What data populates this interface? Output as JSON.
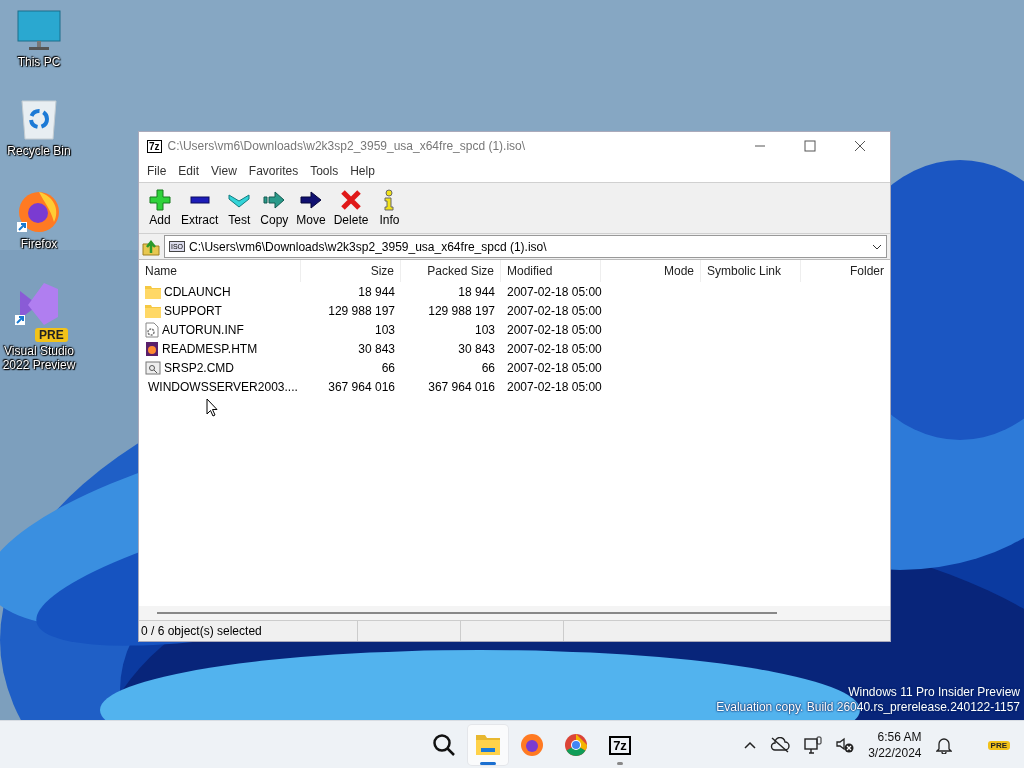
{
  "desktop_icons": [
    {
      "kind": "pc",
      "label": "This PC"
    },
    {
      "kind": "bin",
      "label": "Recycle Bin"
    },
    {
      "kind": "firefox",
      "label": "Firefox"
    },
    {
      "kind": "vs",
      "label": "Visual Studio 2022 Preview",
      "badge": "PRE"
    }
  ],
  "window": {
    "title": "C:\\Users\\vm6\\Downloads\\w2k3sp2_3959_usa_x64fre_spcd (1).iso\\",
    "app_icon": "7z"
  },
  "menu": [
    "File",
    "Edit",
    "View",
    "Favorites",
    "Tools",
    "Help"
  ],
  "toolbar": [
    {
      "kind": "add",
      "label": "Add"
    },
    {
      "kind": "extract",
      "label": "Extract"
    },
    {
      "kind": "test",
      "label": "Test"
    },
    {
      "kind": "copy",
      "label": "Copy"
    },
    {
      "kind": "move",
      "label": "Move"
    },
    {
      "kind": "delete",
      "label": "Delete"
    },
    {
      "kind": "info",
      "label": "Info"
    }
  ],
  "address": {
    "value": "C:\\Users\\vm6\\Downloads\\w2k3sp2_3959_usa_x64fre_spcd (1).iso\\",
    "icon": "ISO"
  },
  "table": {
    "columns": [
      {
        "label": "Name"
      },
      {
        "label": "Size"
      },
      {
        "label": "Packed Size"
      },
      {
        "label": "Modified"
      },
      {
        "label": "Mode"
      },
      {
        "label": "Symbolic Link"
      },
      {
        "label": "Folder"
      }
    ],
    "rows": [
      {
        "kind": "folder",
        "name": "CDLAUNCH",
        "size": "18 944",
        "packed": "18 944",
        "modified": "2007-02-18 05:00"
      },
      {
        "kind": "folder",
        "name": "SUPPORT",
        "size": "129 988 197",
        "packed": "129 988 197",
        "modified": "2007-02-18 05:00"
      },
      {
        "kind": "settings",
        "name": "AUTORUN.INF",
        "size": "103",
        "packed": "103",
        "modified": "2007-02-18 05:00"
      },
      {
        "kind": "web",
        "name": "READMESP.HTM",
        "size": "30 843",
        "packed": "30 843",
        "modified": "2007-02-18 05:00"
      },
      {
        "kind": "script",
        "name": "SRSP2.CMD",
        "size": "66",
        "packed": "66",
        "modified": "2007-02-18 05:00"
      },
      {
        "kind": "app",
        "name": "WINDOWSSERVER2003....",
        "size": "367 964 016",
        "packed": "367 964 016",
        "modified": "2007-02-18 05:00"
      }
    ]
  },
  "status_bar": [
    "0 / 6 object(s) selected"
  ],
  "watermark_lines": [
    "Windows 11 Pro Insider Preview",
    "Evaluation copy. Build 26040.rs_prerelease.240122-1157"
  ],
  "taskbar": {
    "apps": [
      {
        "kind": "search",
        "selected": false,
        "open": false
      },
      {
        "kind": "explorer",
        "selected": true,
        "open": true
      },
      {
        "kind": "firefox",
        "selected": false,
        "open": false
      },
      {
        "kind": "chrome",
        "selected": false,
        "open": false
      },
      {
        "kind": "sevenzip",
        "label": "7z",
        "selected": false,
        "open": true
      }
    ],
    "time": "6:56 AM",
    "date": "3/22/2024",
    "badge": "PRE"
  }
}
